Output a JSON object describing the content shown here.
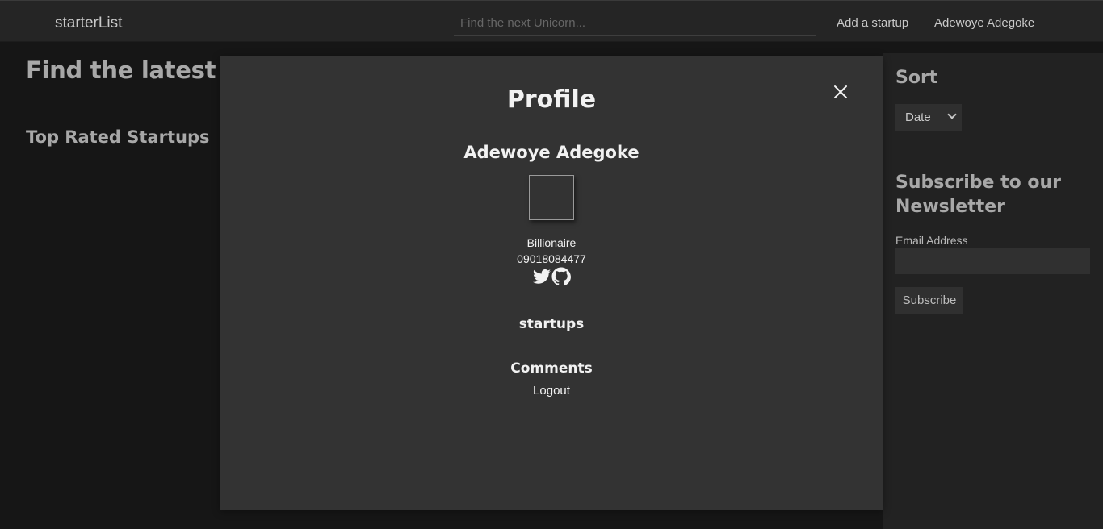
{
  "navbar": {
    "brand": "starterList",
    "search_placeholder": "Find the next Unicorn...",
    "add_startup": "Add a startup",
    "user_name": "Adewoye Adegoke"
  },
  "main": {
    "title": "Find the latest startups",
    "section_title": "Top Rated Startups"
  },
  "sidebar": {
    "sort_title": "Sort",
    "sort_value": "Date",
    "newsletter_title": "Subscribe to our Newsletter",
    "email_label": "Email Address",
    "subscribe_label": "Subscribe"
  },
  "modal": {
    "title": "Profile",
    "name": "Adewoye Adegoke",
    "bio": "Billionaire",
    "phone": "09018084477",
    "startups_heading": "startups",
    "comments_heading": "Comments",
    "logout_label": "Logout",
    "icons": [
      "close-icon",
      "twitter-icon",
      "github-icon"
    ]
  },
  "colors": {
    "page_bg": "#161616",
    "navbar_bg": "#252525",
    "modal_bg": "#333333",
    "sidebar_bg": "#222222",
    "modal_text": "#f2f2f2",
    "muted_text": "#a8a8a8"
  }
}
